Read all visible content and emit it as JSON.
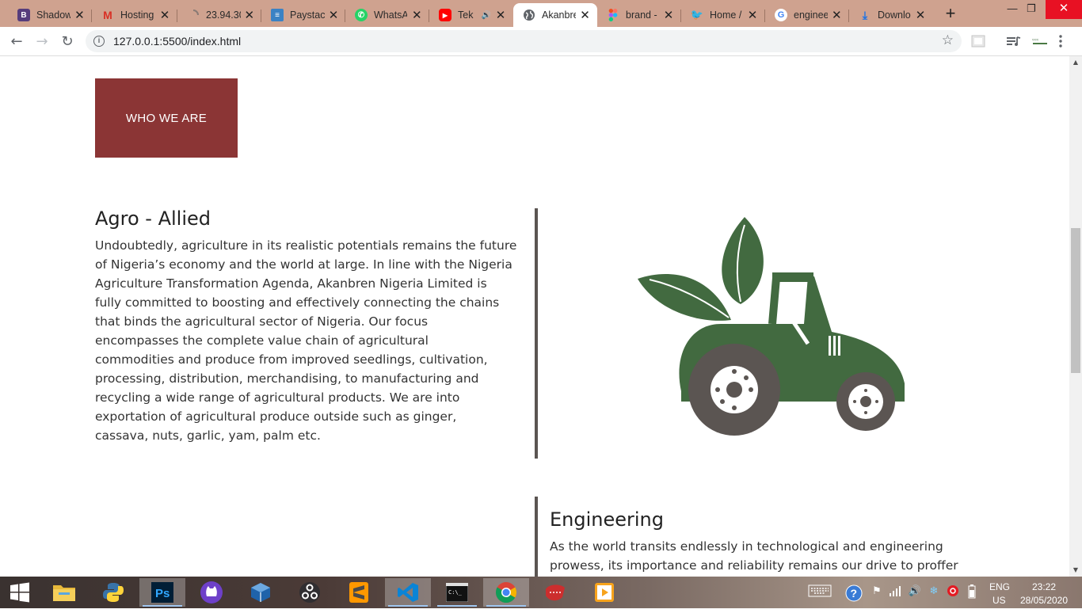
{
  "browser": {
    "tabs": [
      {
        "title": "Shadow",
        "favicon": "B",
        "favicon_color": "#563d7c"
      },
      {
        "title": "Hosting",
        "favicon": "M",
        "favicon_color": "#d93025"
      },
      {
        "title": "23.94.30",
        "favicon": "",
        "favicon_color": "#9a8a84"
      },
      {
        "title": "Paystack",
        "favicon": "",
        "favicon_color": "#3b82c4"
      },
      {
        "title": "WhatsA",
        "favicon": "",
        "favicon_color": "#25d366"
      },
      {
        "title": "Tek",
        "favicon": "",
        "favicon_color": "#ff0000",
        "playing_audio": true
      },
      {
        "title": "Akanbre",
        "favicon": "",
        "favicon_color": "#5f6368",
        "active": true
      },
      {
        "title": "brand -",
        "favicon": "",
        "favicon_color": "#f24e1e"
      },
      {
        "title": "Home /",
        "favicon": "",
        "favicon_color": "#1da1f2"
      },
      {
        "title": "enginee",
        "favicon": "G",
        "favicon_color": "#4285f4"
      },
      {
        "title": "Downlo",
        "favicon": "",
        "favicon_color": "#1a73e8"
      }
    ],
    "new_tab_label": "+",
    "url": "127.0.0.1:5500/index.html"
  },
  "page": {
    "who_button_label": "WHO WE ARE",
    "agro": {
      "title": "Agro - Allied",
      "lines": [
        "Undoubtedly, agriculture in its realistic potentials remains the future",
        "of Nigeria’s economy and the world at large. In line with the Nigeria",
        "Agriculture Transformation Agenda, Akanbren Nigeria Limited is",
        "fully committed to boosting and effectively connecting the chains",
        "that binds the agricultural sector of Nigeria. Our focus",
        "encompasses the complete value chain of agricultural",
        "commodities and produce from improved seedlings, cultivation,",
        "processing, distribution, merchandising, to manufacturing and",
        "recycling a wide range of agricultural products. We are into",
        "exportation of agricultural produce outside such as ginger,",
        "cassava, nuts, garlic, yam, palm etc."
      ],
      "image_icon": "tractor-with-leaves-icon",
      "tractor_body_color": "#426a40",
      "wheel_color": "#5b5552"
    },
    "engineering": {
      "title": "Engineering",
      "lines": [
        "As the world transits endlessly in technological and engineering",
        "prowess, its importance and reliability remains our drive to proffer"
      ]
    },
    "accent_color": "#8b3535"
  },
  "taskbar": {
    "apps": [
      "file-explorer-icon",
      "python-icon",
      "photoshop-icon",
      "github-desktop-icon",
      "virtualbox-icon",
      "obs-icon",
      "sublime-text-icon",
      "vscode-icon",
      "command-prompt-icon",
      "chrome-icon",
      "ruby-icon",
      "media-player-icon"
    ],
    "ps_label": "Ps",
    "lang": "ENG",
    "region": "US",
    "time": "23:22",
    "date": "28/05/2020"
  }
}
